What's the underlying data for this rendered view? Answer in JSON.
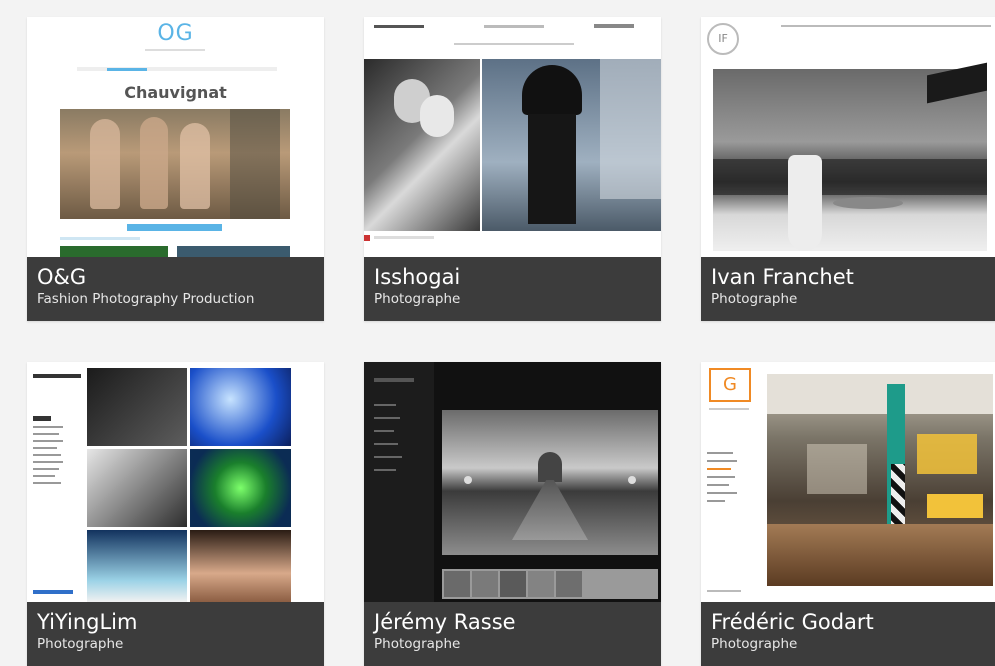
{
  "cards": [
    {
      "title": "O&G",
      "subtitle": "Fashion Photography Production",
      "thumb_heading": "Chauvignat",
      "logo": "OG"
    },
    {
      "title": "Isshogai",
      "subtitle": "Photographe"
    },
    {
      "title": "Ivan Franchet",
      "subtitle": "Photographe",
      "logo": "IF"
    },
    {
      "title": "YiYingLim",
      "subtitle": "Photographe"
    },
    {
      "title": "Jérémy Rasse",
      "subtitle": "Photographe"
    },
    {
      "title": "Frédéric Godart",
      "subtitle": "Photographe",
      "logo": "G"
    }
  ],
  "colors": {
    "caption_bg": "#3c3c3c",
    "page_bg": "#f3f3f3",
    "og_accent": "#5ab4e6",
    "godart_accent": "#f08a24"
  }
}
